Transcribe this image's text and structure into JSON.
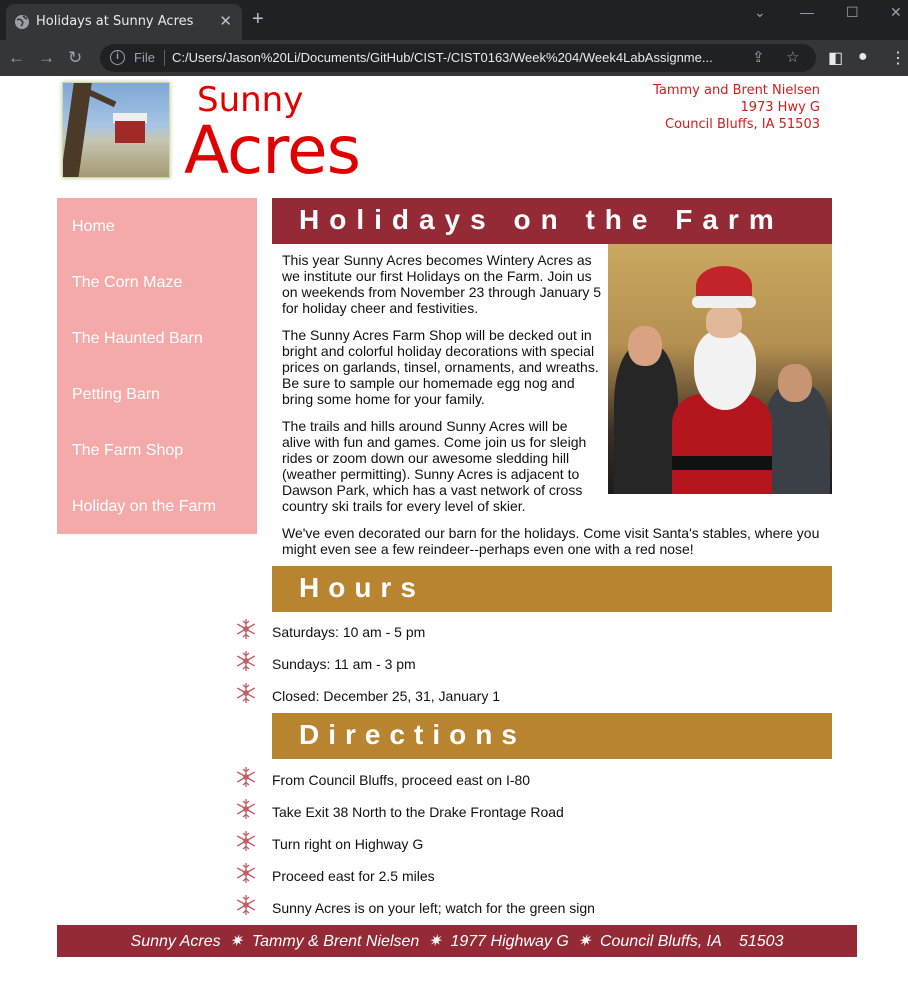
{
  "browser": {
    "tab_title": "Holidays at Sunny Acres",
    "file_label": "File",
    "url": "C:/Users/Jason%20Li/Documents/GitHub/CIST-/CIST0163/Week%204/Week4LabAssignme..."
  },
  "header": {
    "logo_word1": "Sunny",
    "logo_word2": "Acres",
    "address": [
      "Tammy and Brent Nielsen",
      "1973 Hwy G",
      "Council Bluffs, IA  51503"
    ]
  },
  "nav": {
    "items": [
      "Home",
      "The Corn Maze",
      "The Haunted Barn",
      "Petting Barn",
      "The Farm Shop",
      "Holiday on the Farm"
    ]
  },
  "main": {
    "title": "Holidays on the Farm",
    "paragraphs": [
      "This year Sunny Acres becomes Wintery Acres as we institute our first Holidays on the Farm. Join us on weekends from November 23 through January 5 for holiday cheer and festivities.",
      "The Sunny Acres Farm Shop will be decked out in bright and colorful holiday decorations with special prices on garlands, tinsel, ornaments, and wreaths. Be sure to sample our homemade egg nog and bring some home for your family.",
      "The trails and hills around Sunny Acres will be alive with fun and games. Come join us for sleigh rides or zoom down our awesome sledding hill (weather permitting). Sunny Acres is adjacent to Dawson Park, which has a vast network of cross country ski trails for every level of skier.",
      "We've even decorated our barn for the holidays. Come visit Santa's stables, where you might even see a few reindeer--perhaps even one with a red nose!"
    ]
  },
  "hours": {
    "title": "Hours",
    "items": [
      "Saturdays: 10 am - 5 pm",
      "Sundays: 11 am - 3 pm",
      "Closed: December 25, 31, January 1"
    ]
  },
  "directions": {
    "title": "Directions",
    "items": [
      "From Council Bluffs, proceed east on I-80",
      "Take Exit 38 North to the Drake Frontage Road",
      "Turn right on Highway G",
      "Proceed east for 2.5 miles",
      "Sunny Acres is on your left; watch for the green sign"
    ]
  },
  "footer": {
    "text": "Sunny Acres  ✷  Tammy & Brent Nielsen  ✷  1977 Highway G  ✷  Council Bluffs, IA    51503"
  },
  "colors": {
    "accent_red": "#942a36",
    "accent_gold": "#b88430",
    "nav_pink": "#f5aaaa",
    "logo_red": "#e00000"
  }
}
